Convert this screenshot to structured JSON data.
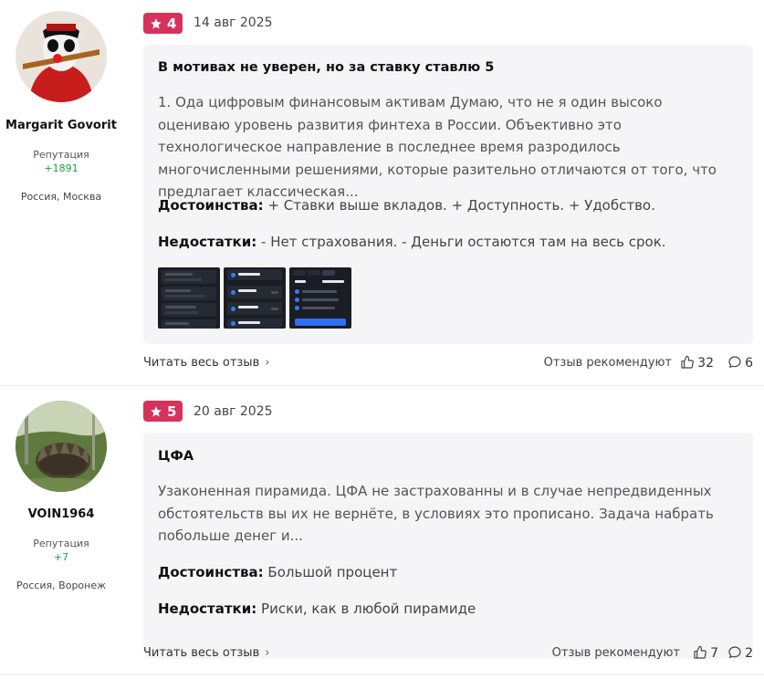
{
  "reviews": [
    {
      "author": {
        "name": "Margarit Govorit",
        "reputation_label": "Репутация",
        "reputation_value": "+1891",
        "location": "Россия, Москва"
      },
      "rating": "4",
      "date": "14 авг 2025",
      "title": "В мотивах не уверен, но за ставку ставлю 5",
      "body": "1. Ода цифровым финансовым активам Думаю, что не я один высоко оцениваю уровень развития финтеха в России. Объективно это технологическое направление в последнее время разродилось многочисленными решениями, которые разительно отличаются от того, что предлагает классическая...",
      "pros_label": "Достоинства:",
      "pros": "+ Ставки выше вкладов. + Доступность. + Удобство.",
      "cons_label": "Недостатки:",
      "cons": "- Нет страхования. - Деньги остаются там на весь срок.",
      "read_more": "Читать весь отзыв",
      "recommend_label": "Отзыв рекомендуют",
      "likes": "32",
      "comments": "6"
    },
    {
      "author": {
        "name": "VOIN1964",
        "reputation_label": "Репутация",
        "reputation_value": "+7",
        "location": "Россия, Воронеж"
      },
      "rating": "5",
      "date": "20 авг 2025",
      "title": "ЦФА",
      "body": "Узаконенная пирамида. ЦФА не застрахованны и в случае непредвиденных обстоятельств вы их не вернёте, в условиях это прописано. Задача набрать побольше денег и...",
      "pros_label": "Достоинства:",
      "pros": "Большой процент",
      "cons_label": "Недостатки:",
      "cons": "Риски, как в любой пирамиде",
      "read_more": "Читать весь отзыв",
      "recommend_label": "Отзыв рекомендуют",
      "likes": "7",
      "comments": "2"
    }
  ],
  "colors": {
    "rating_badge": "#d6335c",
    "reputation_positive": "#1aa33a",
    "card_background": "#f5f5f7"
  },
  "icons": {
    "rating": "star-icon",
    "likes": "thumbs-up-icon",
    "comments": "comment-bubble-icon",
    "read_more": "chevron-right-icon"
  }
}
